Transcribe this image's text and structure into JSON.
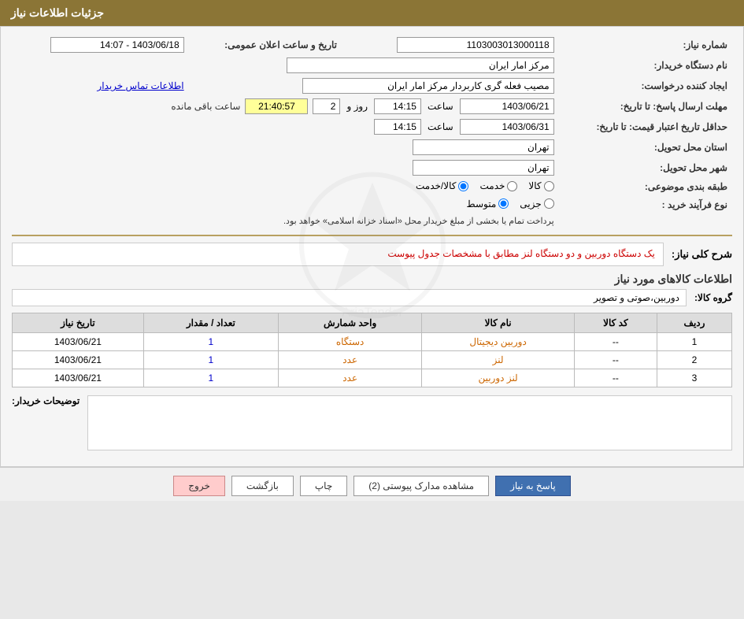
{
  "header": {
    "title": "جزئیات اطلاعات نیاز"
  },
  "fields": {
    "need_number_label": "شماره نیاز:",
    "need_number_value": "1103003013000118",
    "announcement_date_label": "تاریخ و ساعت اعلان عمومی:",
    "announcement_date_value": "1403/06/18 - 14:07",
    "buyer_name_label": "نام دستگاه خریدار:",
    "buyer_name_value": "مرکز امار ایران",
    "requester_label": "ایجاد کننده درخواست:",
    "requester_value": "مصیب فعله گری کاربردار مرکز امار ایران",
    "contact_link": "اطلاعات تماس خریدار",
    "deadline_label": "مهلت ارسال پاسخ: تا تاریخ:",
    "deadline_date": "1403/06/21",
    "deadline_time_label": "ساعت",
    "deadline_time": "14:15",
    "deadline_days_label": "روز و",
    "deadline_days": "2",
    "remaining_timer": "21:40:57",
    "remaining_label": "ساعت باقی مانده",
    "validity_label": "حداقل تاریخ اعتبار قیمت: تا تاریخ:",
    "validity_date": "1403/06/31",
    "validity_time_label": "ساعت",
    "validity_time": "14:15",
    "province_label": "استان محل تحویل:",
    "province_value": "تهران",
    "city_label": "شهر محل تحویل:",
    "city_value": "تهران",
    "category_label": "طبقه بندی موضوعی:",
    "category_options": [
      "کالا",
      "خدمت",
      "کالا/خدمت"
    ],
    "category_selected": "خدمت",
    "purchase_type_label": "نوع فرآیند خرید :",
    "purchase_type_options": [
      "جزیی",
      "متوسط"
    ],
    "purchase_type_selected": "متوسط",
    "purchase_note": "پرداخت تمام یا بخشی از مبلغ خریدار محل «اسناد خزانه اسلامی» خواهد بود.",
    "description_label": "شرح کلی نیاز:",
    "description_value": "یک دستگاه دوربین و دو دستگاه لنز مطابق با مشخصات جدول پیوست",
    "goods_section_title": "اطلاعات کالاهای مورد نیاز",
    "goods_group_label": "گروه کالا:",
    "goods_group_value": "دوربین،صوتی و تصویر",
    "table": {
      "headers": [
        "ردیف",
        "کد کالا",
        "نام کالا",
        "واحد شمارش",
        "تعداد / مقدار",
        "تاریخ نیاز"
      ],
      "rows": [
        {
          "id": "1",
          "code": "--",
          "name": "دوربین دیجیتال",
          "unit": "دستگاه",
          "qty": "1",
          "date": "1403/06/21"
        },
        {
          "id": "2",
          "code": "--",
          "name": "لنز",
          "unit": "عدد",
          "qty": "1",
          "date": "1403/06/21"
        },
        {
          "id": "3",
          "code": "--",
          "name": "لنز دوربین",
          "unit": "عدد",
          "qty": "1",
          "date": "1403/06/21"
        }
      ]
    },
    "notes_label": "توضیحات خریدار:",
    "notes_value": ""
  },
  "buttons": {
    "reply": "پاسخ به نیاز",
    "view_docs": "مشاهده مدارک پیوستی (2)",
    "print": "چاپ",
    "back": "بازگشت",
    "exit": "خروج"
  }
}
